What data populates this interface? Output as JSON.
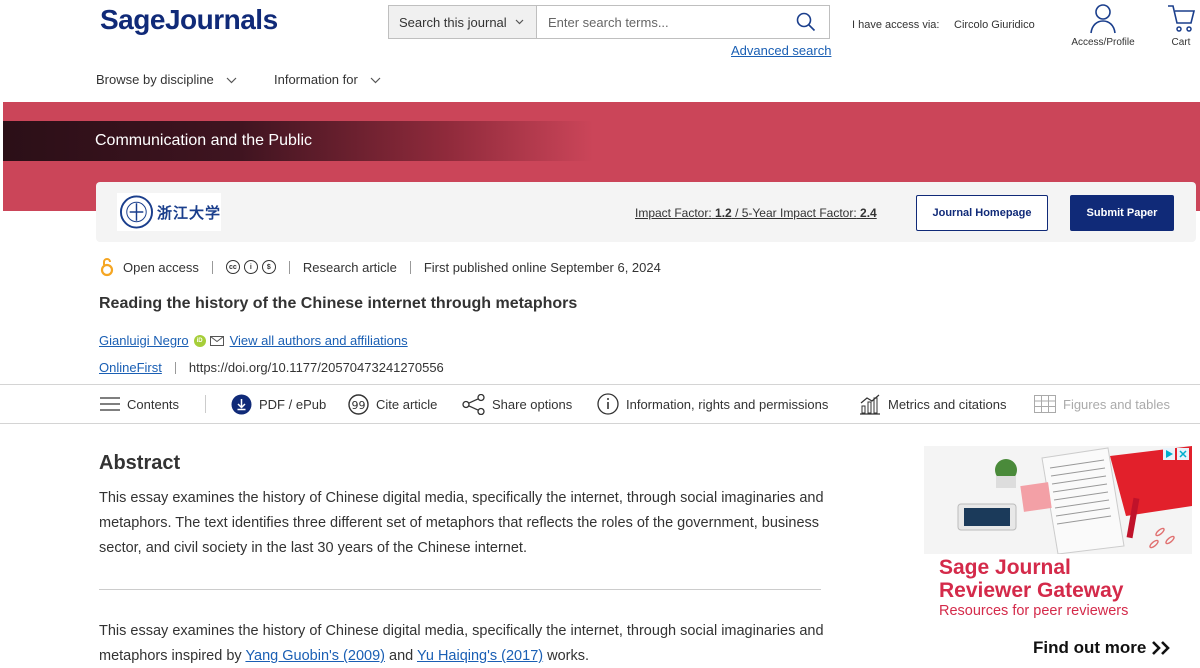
{
  "header": {
    "logo_sage": "Sage",
    "logo_journals": "Journals",
    "search_scope": "Search this journal",
    "search_placeholder": "Enter search terms...",
    "advanced_search": "Advanced search",
    "access_label": "I have access via:",
    "access_institution": "Circolo Giuridico",
    "account_label": "Access/Profile",
    "cart_label": "Cart"
  },
  "nav": {
    "browse": "Browse by discipline",
    "info": "Information for"
  },
  "journal": {
    "name": "Communication and the Public",
    "logo_text": "浙江大学",
    "impact_label": "Impact Factor:",
    "impact_value": "1.2",
    "five_year_label": "/ 5-Year Impact Factor:",
    "five_year_value": "2.4",
    "homepage_button": "Journal Homepage",
    "submit_button": "Submit Paper"
  },
  "article": {
    "access": "Open access",
    "type": "Research article",
    "published": "First published online September 6, 2024",
    "title": "Reading the history of the Chinese internet through metaphors",
    "author": "Gianluigi Negro",
    "view_authors": "View all authors and affiliations",
    "status": "OnlineFirst",
    "doi": "https://doi.org/10.1177/20570473241270556"
  },
  "toolbar": {
    "contents": "Contents",
    "pdf": "PDF / ePub",
    "cite": "Cite article",
    "share": "Share options",
    "info": "Information, rights and permissions",
    "metrics": "Metrics and citations",
    "figures": "Figures and tables"
  },
  "abstract": {
    "heading": "Abstract",
    "text": "This essay examines the history of Chinese digital media, specifically the internet, through social imaginaries and metaphors. The text identifies three different set of metaphors that reflects the roles of the government, business sector, and civil society in the last 30 years of the Chinese internet."
  },
  "body": {
    "text_start": "This essay examines the history of Chinese digital media, specifically the internet, through social imaginaries and metaphors inspired by ",
    "ref1": "Yang Guobin's (2009)",
    "text_mid": " and ",
    "ref2": "Yu Haiqing's (2017)",
    "text_end": " works."
  },
  "ad": {
    "title": "Sage Journal Reviewer Gateway",
    "subtitle": "Resources for peer reviewers",
    "cta": "Find out more"
  },
  "colors": {
    "brand_navy": "#102a78",
    "banner_red": "#cb4559",
    "ad_red": "#d42a4a",
    "link_blue": "#1a5fb4"
  }
}
